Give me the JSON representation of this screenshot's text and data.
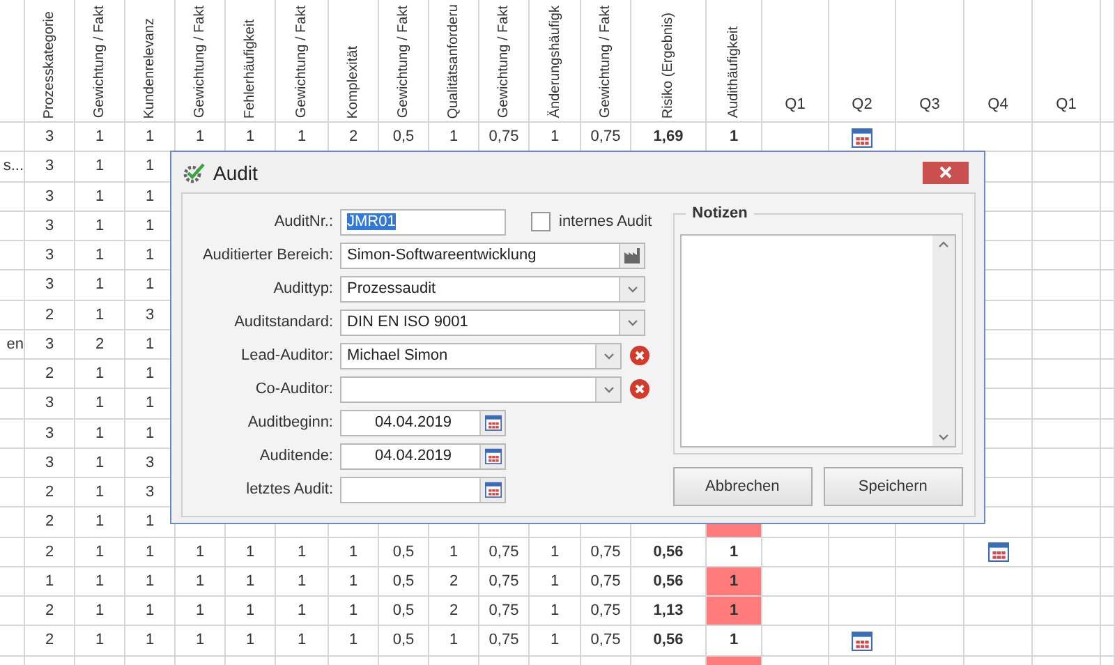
{
  "grid": {
    "columns": [
      "Prozesskategorie",
      "Gewichtung / Fakt",
      "Kundenrelevanz",
      "Gewichtung / Fakt",
      "Fehlerhäufigkeit",
      "Gewichtung / Fakt",
      "Komplexität",
      "Gewichtung / Fakt",
      "Qualitätsanforderu",
      "Gewichtung / Fakt",
      "Änderungshäufigk",
      "Gewichtung / Fakt",
      "Risiko (Ergebnis)",
      "Audithäufigkeit",
      "Q1",
      "Q2",
      "Q3",
      "Q4",
      "Q1"
    ],
    "rows": [
      {
        "cells": [
          "3",
          "1",
          "1",
          "1",
          "1",
          "1",
          "2",
          "0,5",
          "1",
          "0,75",
          "1",
          "0,75",
          "1,69",
          "1"
        ],
        "highlighted": false,
        "calendar": [
          false,
          true,
          false,
          false,
          false
        ]
      },
      {
        "name": "s...",
        "cells": [
          "3",
          "1",
          "1"
        ]
      },
      {
        "cells": [
          "3",
          "1",
          "1"
        ]
      },
      {
        "cells": [
          "3",
          "1",
          "1"
        ]
      },
      {
        "cells": [
          "3",
          "1",
          "1"
        ]
      },
      {
        "cells": [
          "3",
          "1",
          "1"
        ]
      },
      {
        "cells": [
          "2",
          "1",
          "3"
        ]
      },
      {
        "name": "en",
        "cells": [
          "3",
          "2",
          "1"
        ]
      },
      {
        "cells": [
          "2",
          "1",
          "1"
        ]
      },
      {
        "cells": [
          "3",
          "1",
          "1"
        ]
      },
      {
        "cells": [
          "3",
          "1",
          "1"
        ]
      },
      {
        "cells": [
          "3",
          "1",
          "3"
        ]
      },
      {
        "cells": [
          "2",
          "1",
          "3"
        ]
      },
      {
        "cells": [
          "2",
          "1",
          "1"
        ],
        "highlighted": true,
        "calendar": [
          false,
          false,
          false,
          false,
          false
        ]
      },
      {
        "cells": [
          "2",
          "1",
          "1",
          "1",
          "1",
          "1",
          "1",
          "0,5",
          "1",
          "0,75",
          "1",
          "0,75",
          "0,56",
          "1"
        ],
        "highlighted": false,
        "calendar": [
          false,
          false,
          false,
          true,
          false
        ]
      },
      {
        "cells": [
          "1",
          "1",
          "1",
          "1",
          "1",
          "1",
          "1",
          "0,5",
          "2",
          "0,75",
          "1",
          "0,75",
          "0,56",
          "1"
        ],
        "highlighted": true,
        "calendar": [
          false,
          false,
          false,
          false,
          false
        ]
      },
      {
        "cells": [
          "2",
          "1",
          "1",
          "1",
          "1",
          "1",
          "1",
          "0,5",
          "2",
          "0,75",
          "1",
          "0,75",
          "1,13",
          "1"
        ],
        "highlighted": true,
        "calendar": [
          false,
          false,
          false,
          false,
          false
        ]
      },
      {
        "cells": [
          "2",
          "1",
          "1",
          "1",
          "1",
          "1",
          "1",
          "0,5",
          "1",
          "0,75",
          "1",
          "0,75",
          "0,56",
          "1"
        ],
        "highlighted": false,
        "calendar": [
          false,
          true,
          false,
          false,
          false
        ]
      },
      {
        "cells": [],
        "highlighted": true
      }
    ]
  },
  "dialog": {
    "title": "Audit",
    "fields": [
      {
        "label": "AuditNr.:",
        "kind": "text",
        "value": "JMR01",
        "highlighted": true
      },
      {
        "label": "Auditierter Bereich:",
        "kind": "picker",
        "value": "Simon-Softwareentwicklung"
      },
      {
        "label": "Audittyp:",
        "kind": "select",
        "value": "Prozessaudit"
      },
      {
        "label": "Auditstandard:",
        "kind": "select",
        "value": "DIN EN ISO 9001"
      },
      {
        "label": "Lead-Auditor:",
        "kind": "select_clear",
        "value": "Michael Simon"
      },
      {
        "label": "Co-Auditor:",
        "kind": "select_clear"
      },
      {
        "label": "Auditbeginn:",
        "kind": "date",
        "value": "04.04.2019"
      },
      {
        "label": "Auditende:",
        "kind": "date",
        "value": "04.04.2019"
      },
      {
        "label": "letztes Audit:",
        "kind": "date"
      }
    ],
    "checkbox": {
      "label": "internes Audit",
      "checked": false
    },
    "notes": {
      "title": "Notizen"
    },
    "buttons": [
      "Abbrechen",
      "Speichern"
    ]
  }
}
